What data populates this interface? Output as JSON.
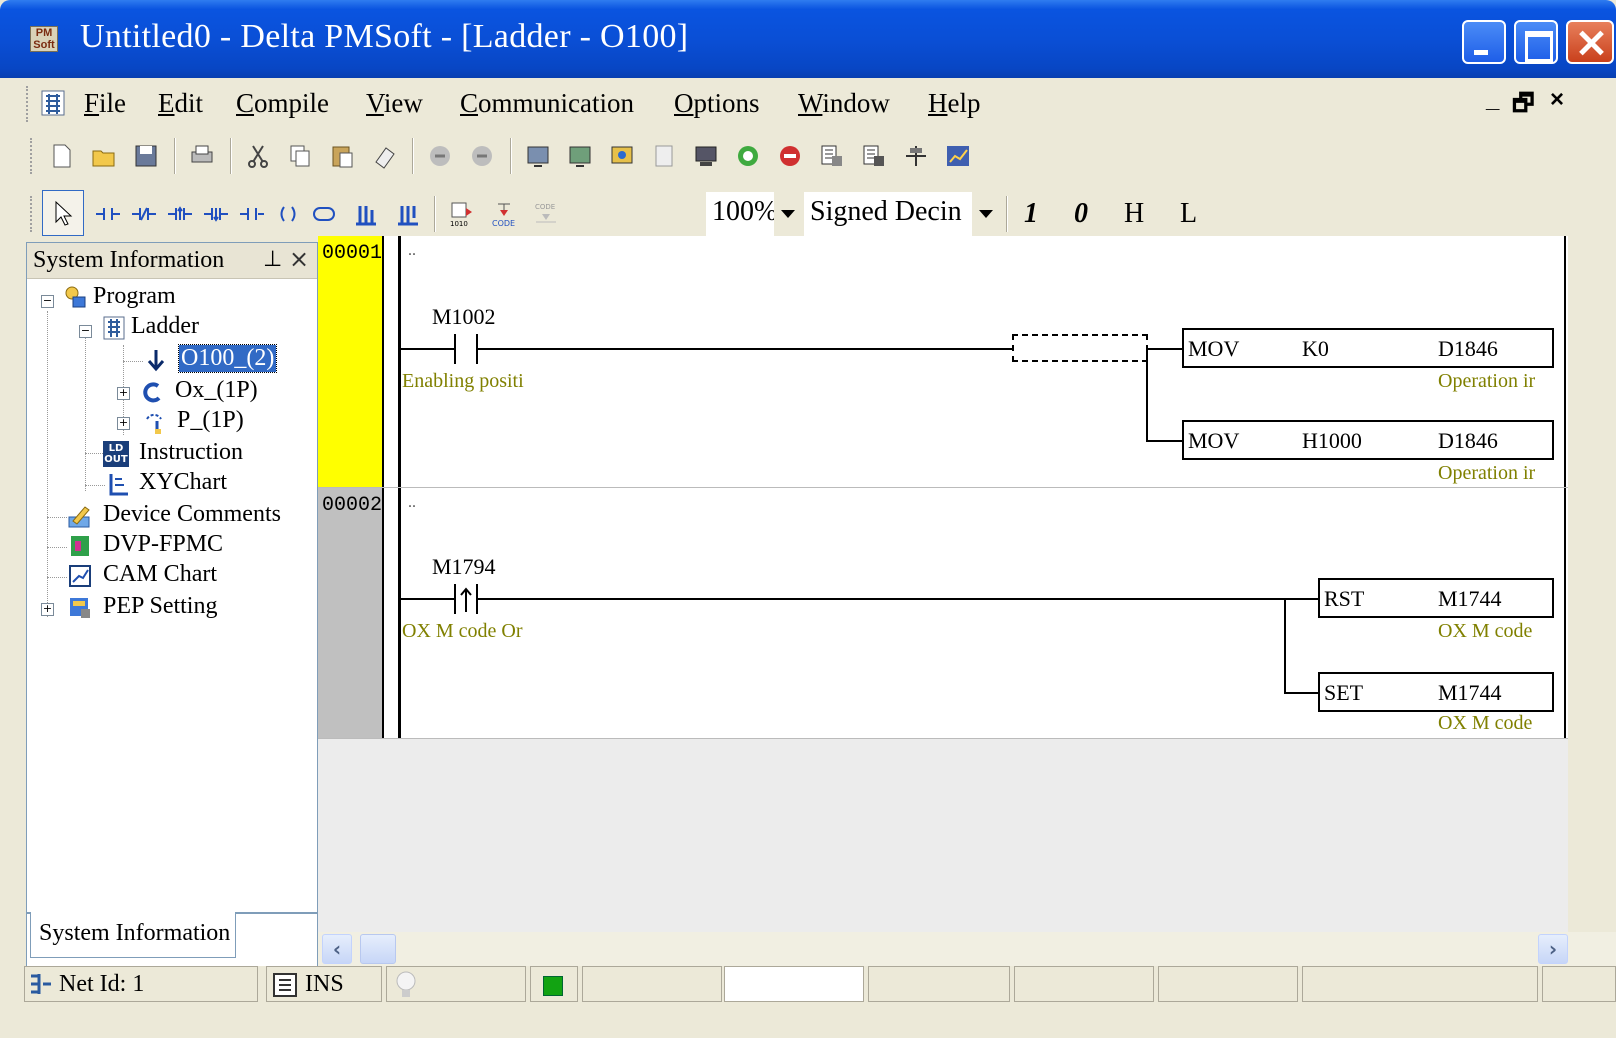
{
  "window": {
    "title": "Untitled0 - Delta PMSoft - [Ladder - O100]",
    "app_icon_text": "PM Soft"
  },
  "menu": {
    "items": [
      {
        "label": "File",
        "accel": "F"
      },
      {
        "label": "Edit",
        "accel": "E"
      },
      {
        "label": "Compile",
        "accel": "C"
      },
      {
        "label": "View",
        "accel": "V"
      },
      {
        "label": "Communication",
        "accel": "C"
      },
      {
        "label": "Options",
        "accel": "O"
      },
      {
        "label": "Window",
        "accel": "W"
      },
      {
        "label": "Help",
        "accel": "H"
      }
    ],
    "mdi_controls": "_ 🗗 ×"
  },
  "toolbar2": {
    "zoom": "100%",
    "format": "Signed Decin",
    "btn_1": "1",
    "btn_0": "0",
    "btn_H": "H",
    "btn_L": "L"
  },
  "side_panel": {
    "header": "System Information",
    "pin": "ꟷ",
    "close": "×",
    "tab": "System Information",
    "tree": {
      "program": "Program",
      "ladder": "Ladder",
      "o100": "O100_(2)",
      "ox": "Ox_(1P)",
      "p": "P_(1P)",
      "instruction": "Instruction",
      "xychart": "XYChart",
      "device_comments": "Device Comments",
      "dvp_fpmc": "DVP-FPMC",
      "cam_chart": "CAM Chart",
      "pep_setting": "PEP Setting"
    }
  },
  "ladder": {
    "networks": [
      {
        "number": "00001",
        "comment": "..",
        "contact": {
          "device": "M1002",
          "comment": "Enabling positi"
        },
        "instructions": [
          {
            "op": "MOV",
            "src": "K0",
            "dst": "D1846",
            "comment": "Operation ir"
          },
          {
            "op": "MOV",
            "src": "H1000",
            "dst": "D1846",
            "comment": "Operation ir"
          }
        ]
      },
      {
        "number": "00002",
        "comment": "..",
        "contact": {
          "device": "M1794",
          "comment": "OX M code Or"
        },
        "instructions": [
          {
            "op": "RST",
            "dst": "M1744",
            "comment": "OX M code"
          },
          {
            "op": "SET",
            "dst": "M1744",
            "comment": "OX M code"
          }
        ]
      }
    ]
  },
  "status": {
    "net_id": "Net Id: 1",
    "mode": "INS"
  },
  "colors": {
    "active_network": "#ffff00",
    "inactive_network": "#c0c0c0",
    "comment_text": "#808000",
    "selection": "#316ac5"
  }
}
